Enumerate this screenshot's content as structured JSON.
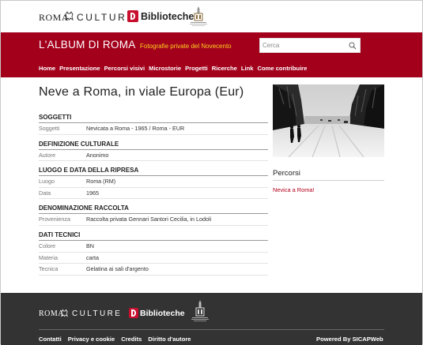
{
  "logos": {
    "roma": "ROMA",
    "culture": "CULTURE",
    "biblioteche": "Biblioteche"
  },
  "header": {
    "site_title": "L'ALBUM DI ROMA",
    "subtitle": "Fotografie private del Novecento",
    "search_placeholder": "Cerca",
    "accent_color": "#a3001c",
    "subtitle_color": "#ffd21f"
  },
  "nav": [
    "Home",
    "Presentazione",
    "Percorsi visivi",
    "Microstorie",
    "Progetti",
    "Ricerche",
    "Link",
    "Come contribuire"
  ],
  "main": {
    "title": "Neve a Roma, in viale Europa (Eur)",
    "sections": [
      {
        "heading": "SOGGETTI",
        "rows": [
          {
            "label": "Soggetti",
            "value": "Nevicata a Roma - 1965 / Roma - EUR"
          }
        ]
      },
      {
        "heading": "DEFINIZIONE CULTURALE",
        "rows": [
          {
            "label": "Autore",
            "value": "Anonimo"
          }
        ]
      },
      {
        "heading": "LUOGO E DATA DELLA RIPRESA",
        "rows": [
          {
            "label": "Luogo",
            "value": "Roma (RM)"
          },
          {
            "label": "Data",
            "value": "1965"
          }
        ]
      },
      {
        "heading": "DENOMINAZIONE RACCOLTA",
        "rows": [
          {
            "label": "Provenienza",
            "value": "Raccolta privata Gennari Santori Cecilia, in Lodoli"
          }
        ]
      },
      {
        "heading": "DATI TECNICI",
        "rows": [
          {
            "label": "Colore",
            "value": "BN"
          },
          {
            "label": "Materia",
            "value": "carta"
          },
          {
            "label": "Tecnica",
            "value": "Gelatina ai sali d'argento"
          }
        ]
      }
    ]
  },
  "sidebar": {
    "percorsi_title": "Percorsi",
    "percorsi_link": "Nevica a Roma!"
  },
  "footer": {
    "links": [
      "Contatti",
      "Privacy e cookie",
      "Credits",
      "Diritto d'autore"
    ],
    "powered": "Powered By SICAPWeb",
    "background": "#333333"
  }
}
